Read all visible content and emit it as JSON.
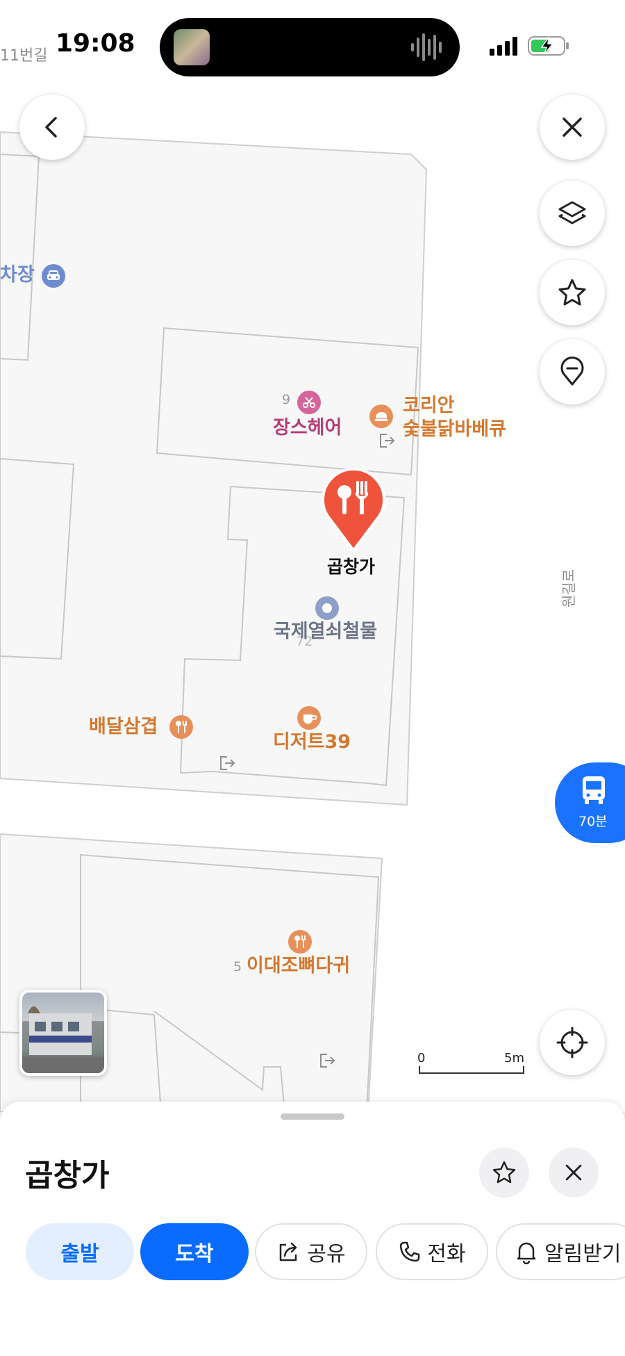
{
  "status_bar": {
    "time": "19:08",
    "street_fragment": "11번길"
  },
  "map": {
    "pois": [
      {
        "name": "차장"
      },
      {
        "number": "9",
        "name": "장스헤어"
      },
      {
        "line1": "코리안",
        "line2": "숯불닭바베큐"
      },
      {
        "name": "곱창가"
      },
      {
        "name": "국제열쇠철물",
        "number": "72"
      },
      {
        "name": "배달삼겹"
      },
      {
        "name": "디저트39"
      },
      {
        "number": "5",
        "name": "이대조뼈다귀"
      }
    ],
    "roads": {
      "right": "원길로"
    },
    "scale": {
      "start": "0",
      "end": "5m"
    },
    "transit": {
      "label": "70분"
    }
  },
  "sheet": {
    "title": "곱창가",
    "actions": {
      "depart": "출발",
      "arrive": "도착",
      "share": "공유",
      "call": "전화",
      "notify": "알림받기"
    }
  },
  "colors": {
    "primary_blue": "#0a6cff",
    "light_blue": "#e3efff",
    "food_orange": "#e0742c",
    "pin_red": "#f0533c",
    "beauty_pink": "#b43d78",
    "parking_blue": "#6f8bd0",
    "store_slate": "#8795b8"
  }
}
